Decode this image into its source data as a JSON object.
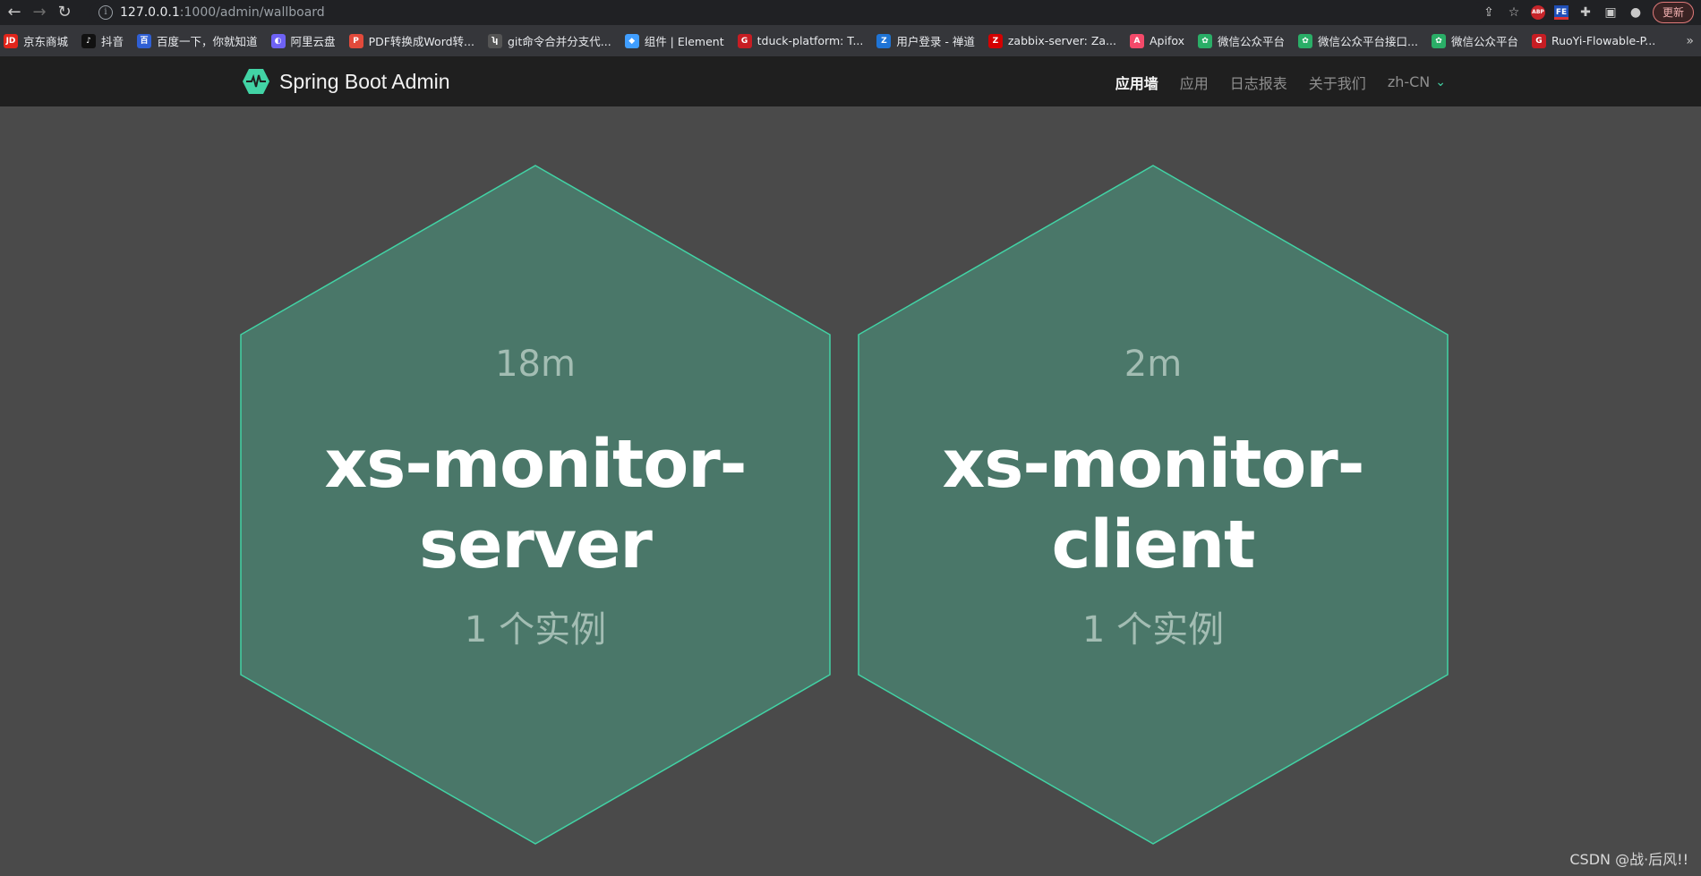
{
  "browser": {
    "url_host": "127.0.0.1",
    "url_path": ":1000/admin/wallboard",
    "update_label": "更新",
    "bookmarks": [
      {
        "label": "京东商城",
        "icon": "jd-icon",
        "color": "#e1251b",
        "glyph": "JD"
      },
      {
        "label": "抖音",
        "icon": "tiktok-icon",
        "color": "#111111",
        "glyph": "♪"
      },
      {
        "label": "百度一下，你就知道",
        "icon": "baidu-icon",
        "color": "#2f5fd4",
        "glyph": "百"
      },
      {
        "label": "阿里云盘",
        "icon": "aliyun-drive-icon",
        "color": "#6e62f5",
        "glyph": "◐"
      },
      {
        "label": "PDF转换成Word转...",
        "icon": "pdf-icon",
        "color": "#e24a3b",
        "glyph": "P"
      },
      {
        "label": "git命令合并分支代...",
        "icon": "git-icon",
        "color": "#555555",
        "glyph": "ʮ"
      },
      {
        "label": "组件 | Element",
        "icon": "element-icon",
        "color": "#409eff",
        "glyph": "◆"
      },
      {
        "label": "tduck-platform: T...",
        "icon": "gitee-icon",
        "color": "#c71d23",
        "glyph": "G"
      },
      {
        "label": "用户登录 - 禅道",
        "icon": "zentao-icon",
        "color": "#1f74d6",
        "glyph": "Z"
      },
      {
        "label": "zabbix-server: Za...",
        "icon": "zabbix-icon",
        "color": "#d40000",
        "glyph": "Z"
      },
      {
        "label": "Apifox",
        "icon": "apifox-icon",
        "color": "#f44a6a",
        "glyph": "A"
      },
      {
        "label": "微信公众平台",
        "icon": "wechat-icon",
        "color": "#2aae67",
        "glyph": "✿"
      },
      {
        "label": "微信公众平台接口...",
        "icon": "wechat-icon",
        "color": "#2aae67",
        "glyph": "✿"
      },
      {
        "label": "微信公众平台",
        "icon": "wechat-icon",
        "color": "#2aae67",
        "glyph": "✿"
      },
      {
        "label": "RuoYi-Flowable-P...",
        "icon": "gitee-icon",
        "color": "#c71d23",
        "glyph": "G"
      }
    ],
    "more_label": "»"
  },
  "app": {
    "title": "Spring Boot Admin",
    "nav": [
      {
        "label": "应用墙",
        "active": true
      },
      {
        "label": "应用",
        "active": false
      },
      {
        "label": "日志报表",
        "active": false
      },
      {
        "label": "关于我们",
        "active": false
      }
    ],
    "language": "zh-CN"
  },
  "applications": [
    {
      "uptime": "18m",
      "name_line1": "xs-monitor-",
      "name_line2": "server",
      "instances": "1 个实例",
      "status": "UP"
    },
    {
      "uptime": "2m",
      "name_line1": "xs-monitor-",
      "name_line2": "client",
      "instances": "1 个实例",
      "status": "UP"
    }
  ],
  "colors": {
    "hex_fill": "#4a7769",
    "hex_stroke": "#42d3a5",
    "accent": "#42d3a5"
  },
  "watermark": "CSDN @战·后风!!"
}
